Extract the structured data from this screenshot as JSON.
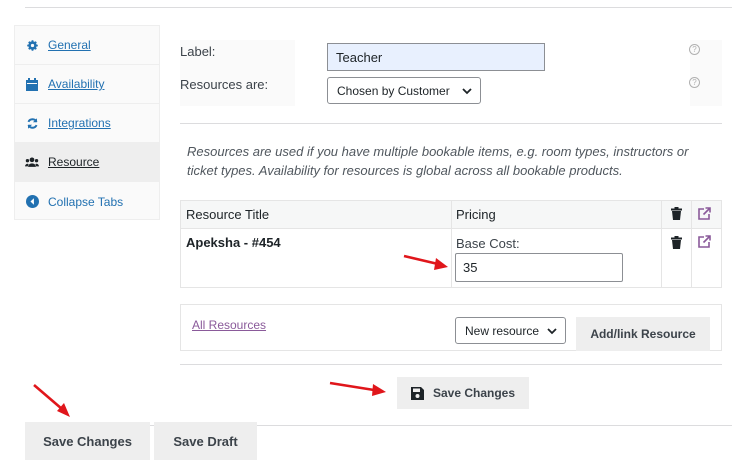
{
  "tabs": [
    {
      "label": "General",
      "icon": "gear-icon"
    },
    {
      "label": "Availability",
      "icon": "calendar-icon"
    },
    {
      "label": "Integrations",
      "icon": "sync-icon"
    },
    {
      "label": "Resource",
      "icon": "users-icon"
    },
    {
      "label": "Collapse Tabs",
      "icon": "collapse-icon"
    }
  ],
  "options": {
    "label_label": "Label:",
    "label_value": "Teacher",
    "resources_are_label": "Resources are:",
    "resources_are_value": "Chosen by Customer"
  },
  "description": "Resources are used if you have multiple bookable items, e.g. room types, instructors or ticket types. Availability for resources is global across all bookable products.",
  "table": {
    "headers": {
      "title": "Resource Title",
      "pricing": "Pricing"
    },
    "rows": [
      {
        "title": "Apeksha - #454",
        "base_cost_label": "Base Cost:",
        "base_cost_value": "35"
      }
    ]
  },
  "footer": {
    "all_resources_link": "All Resources",
    "new_resource_select": "New resource",
    "add_link_button": "Add/link Resource"
  },
  "save_changes_inner": "Save Changes",
  "bottom": {
    "save_changes": "Save Changes",
    "save_draft": "Save Draft"
  },
  "colors": {
    "link": "#2271b1",
    "accent_purple": "#8a5a9a",
    "arrow_red": "#e0161b"
  }
}
